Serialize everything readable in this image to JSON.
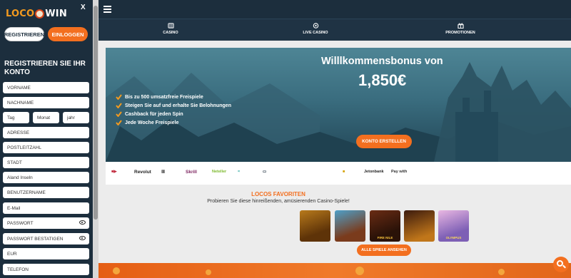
{
  "sidebar": {
    "logo_left": "LOCO",
    "logo_right": "WIN",
    "close": "X",
    "register_btn": "REGISTRIEREN",
    "login_btn": "EINLOGGEN",
    "heading": "REGISTRIEREN SIE IHR KONTO",
    "fields": {
      "vorname": "VORNAME",
      "nachname": "NACHNAME",
      "tag": "Tag",
      "monat": "Monat",
      "jahr": "jahr",
      "adresse": "ADRESSE",
      "postleitzahl": "POSTLEITZAHL",
      "stadt": "STADT",
      "land": "Aland Inseln",
      "benutzername": "BENUTZERNAME",
      "email": "E-Mail",
      "passwort": "PASSWORT",
      "passwort_bestaetigen": "PASSWORT BESTATIGEN",
      "waehrung": "EUR",
      "telefon": "TELEFON"
    }
  },
  "nav": {
    "casino": "CASINO",
    "live_casino": "LIVE CASINO",
    "promotionen": "PROMOTIONEN"
  },
  "hero": {
    "title": "Willlkommensbonus von",
    "amount": "1,850€",
    "bullets": [
      "Bis zu 500 umsatzfreie Freispiele",
      "Steigen Sie auf und erhalte Sie Belohnungen",
      "Cashback für jeden Spin",
      "Jede Woche Freispiele"
    ],
    "cta": "KONTO ERSTELLEN"
  },
  "payments": [
    "Revolut",
    "Skrill",
    "Neteller",
    "Jetonbank",
    "Pay with"
  ],
  "favorites": {
    "title": "LOCOS FAVORITEN",
    "subtitle": "Probieren Sie diese hinreißenden, amüsierenden Casino-Spiele!",
    "games": [
      "",
      "",
      "FIRE NILE",
      "",
      "OLYMPUS"
    ],
    "cta": "ALLE SPIELE ANSEHEN"
  },
  "colors": {
    "accent": "#f36f1f",
    "navy": "#1c2e3d"
  }
}
